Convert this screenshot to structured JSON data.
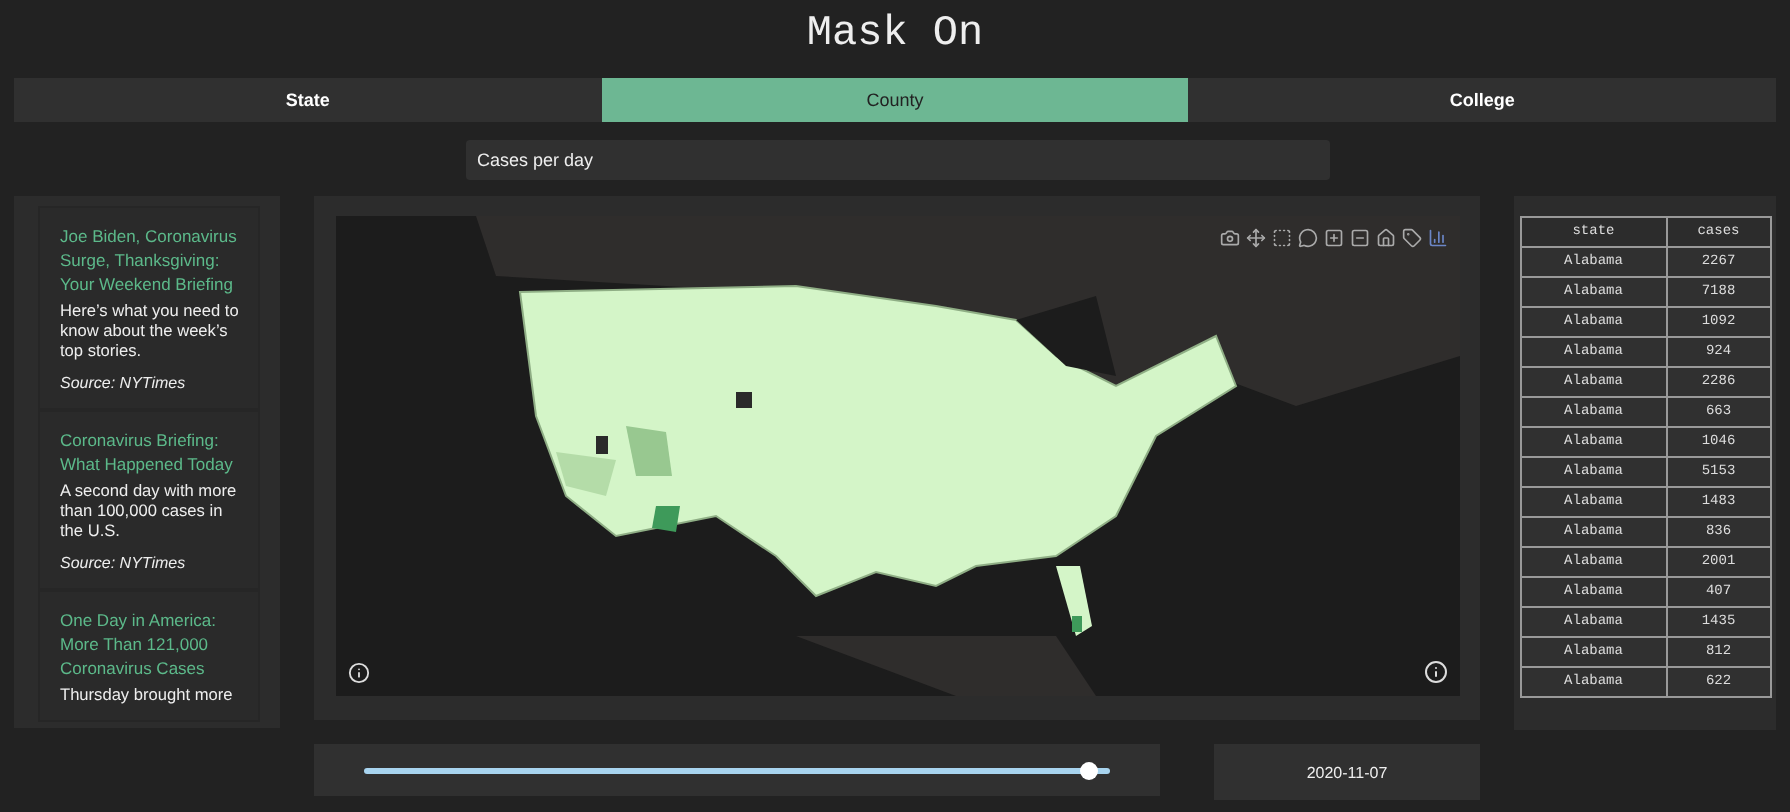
{
  "title": "Mask On",
  "tabs": [
    {
      "label": "State",
      "selected": false
    },
    {
      "label": "County",
      "selected": true
    },
    {
      "label": "College",
      "selected": false
    }
  ],
  "metric_dropdown": {
    "value": "Cases per day"
  },
  "news": [
    {
      "headline": "Joe Biden, Coronavirus Surge, Thanksgiving: Your Weekend Briefing",
      "summary": "Here’s what you need to know about the week’s top stories.",
      "source": "Source: NYTimes"
    },
    {
      "headline": "Coronavirus Briefing: What Happened Today",
      "summary": "A second day with more than 100,000 cases in the U.S.",
      "source": "Source: NYTimes"
    },
    {
      "headline": "One Day in America: More Than 121,000 Coronavirus Cases",
      "summary": "Thursday brought more"
    }
  ],
  "table": {
    "columns": [
      "state",
      "cases"
    ],
    "rows": [
      [
        "Alabama",
        "2267"
      ],
      [
        "Alabama",
        "7188"
      ],
      [
        "Alabama",
        "1092"
      ],
      [
        "Alabama",
        "924"
      ],
      [
        "Alabama",
        "2286"
      ],
      [
        "Alabama",
        "663"
      ],
      [
        "Alabama",
        "1046"
      ],
      [
        "Alabama",
        "5153"
      ],
      [
        "Alabama",
        "1483"
      ],
      [
        "Alabama",
        "836"
      ],
      [
        "Alabama",
        "2001"
      ],
      [
        "Alabama",
        "407"
      ],
      [
        "Alabama",
        "1435"
      ],
      [
        "Alabama",
        "812"
      ],
      [
        "Alabama",
        "622"
      ]
    ]
  },
  "date_slider": {
    "level": 0.97
  },
  "date": "2020-11-07"
}
